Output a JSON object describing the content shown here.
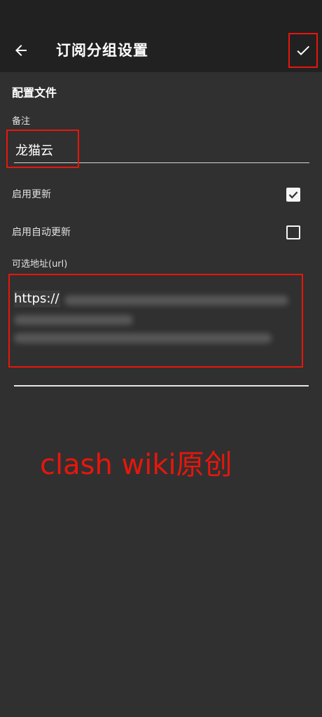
{
  "app_bar": {
    "title": "订阅分组设置",
    "back_icon": "arrow-left-icon",
    "confirm_icon": "check-icon"
  },
  "form": {
    "section_title": "配置文件",
    "remark": {
      "label": "备注",
      "value": "龙猫云"
    },
    "enable_update": {
      "label": "启用更新",
      "checked": true
    },
    "enable_auto_update": {
      "label": "启用自动更新",
      "checked": false
    },
    "url": {
      "label": "可选地址(url)",
      "value_visible": "https://"
    }
  },
  "watermark": "clash wiki原创",
  "colors": {
    "background": "#303030",
    "app_bar": "#212121",
    "highlight": "#e8160c",
    "text": "#ffffff"
  }
}
